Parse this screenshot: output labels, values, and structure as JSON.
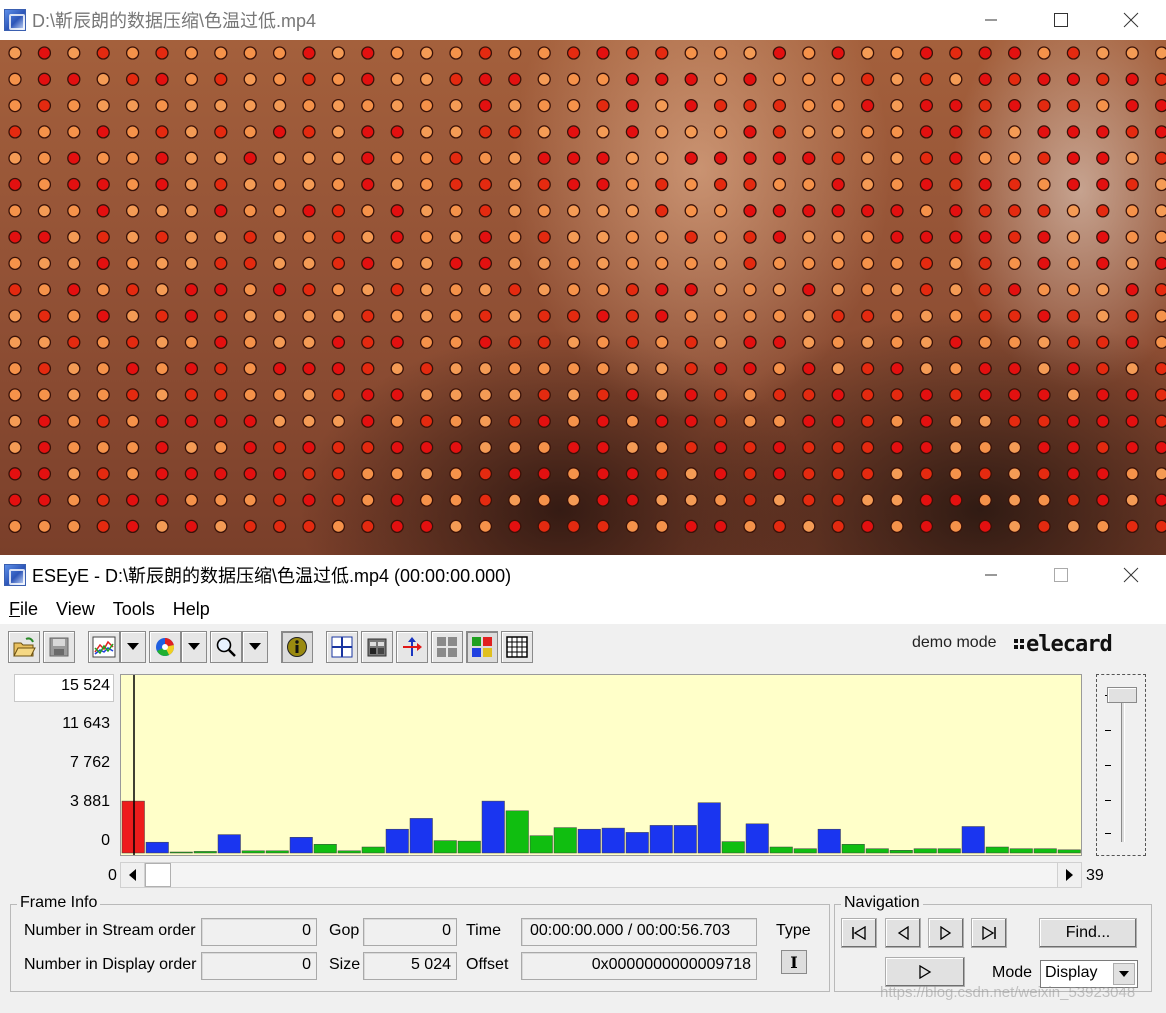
{
  "video_window": {
    "title": "D:\\靳辰朗的数据压缩\\色温过低.mp4",
    "dot_colors": [
      "#e31010",
      "#f5924a",
      "#f49b55",
      "#e42a10"
    ]
  },
  "eseye_window": {
    "title": "ESEyE - D:\\靳辰朗的数据压缩\\色温过低.mp4 (00:00:00.000)"
  },
  "menu": {
    "file": {
      "mnemonic": "F",
      "rest": "ile"
    },
    "view": "View",
    "tools": "Tools",
    "help": "Help"
  },
  "toolbar": {
    "icons": [
      "open-folder-icon",
      "save-icon",
      "chart-icon",
      "color-wheel-icon",
      "zoom-icon",
      "info-icon",
      "crosshair-icon",
      "frame-table-icon",
      "motion-vector-icon",
      "macroblock-grid-icon",
      "macroblock-color-icon",
      "grid-icon"
    ],
    "demo_mode": "demo mode",
    "brand": "elecard"
  },
  "chart_data": {
    "type": "bar",
    "title": "",
    "xlabel": "",
    "ylabel": "",
    "y_ticks": [
      "15 524",
      "11 643",
      "7 762",
      "3 881",
      "0"
    ],
    "ylim": [
      0,
      15524
    ],
    "frame_count_visible": 40,
    "cursor_frame": 0,
    "bars": [
      {
        "frame": 0,
        "value": 4800,
        "type": "I"
      },
      {
        "frame": 1,
        "value": 1000,
        "type": "P"
      },
      {
        "frame": 2,
        "value": 0,
        "type": "B"
      },
      {
        "frame": 3,
        "value": 150,
        "type": "B"
      },
      {
        "frame": 4,
        "value": 1700,
        "type": "P"
      },
      {
        "frame": 5,
        "value": 200,
        "type": "B"
      },
      {
        "frame": 6,
        "value": 200,
        "type": "B"
      },
      {
        "frame": 7,
        "value": 1450,
        "type": "P"
      },
      {
        "frame": 8,
        "value": 800,
        "type": "B"
      },
      {
        "frame": 9,
        "value": 200,
        "type": "B"
      },
      {
        "frame": 10,
        "value": 550,
        "type": "B"
      },
      {
        "frame": 11,
        "value": 2200,
        "type": "P"
      },
      {
        "frame": 12,
        "value": 3200,
        "type": "P"
      },
      {
        "frame": 13,
        "value": 1150,
        "type": "B"
      },
      {
        "frame": 14,
        "value": 1100,
        "type": "B"
      },
      {
        "frame": 15,
        "value": 4800,
        "type": "P"
      },
      {
        "frame": 16,
        "value": 3900,
        "type": "B"
      },
      {
        "frame": 17,
        "value": 1600,
        "type": "B"
      },
      {
        "frame": 18,
        "value": 2350,
        "type": "B"
      },
      {
        "frame": 19,
        "value": 2200,
        "type": "P"
      },
      {
        "frame": 20,
        "value": 2300,
        "type": "P"
      },
      {
        "frame": 21,
        "value": 1900,
        "type": "P"
      },
      {
        "frame": 22,
        "value": 2550,
        "type": "P"
      },
      {
        "frame": 23,
        "value": 2550,
        "type": "P"
      },
      {
        "frame": 24,
        "value": 4650,
        "type": "P"
      },
      {
        "frame": 25,
        "value": 1050,
        "type": "B"
      },
      {
        "frame": 26,
        "value": 2700,
        "type": "P"
      },
      {
        "frame": 27,
        "value": 550,
        "type": "B"
      },
      {
        "frame": 28,
        "value": 400,
        "type": "B"
      },
      {
        "frame": 29,
        "value": 2200,
        "type": "P"
      },
      {
        "frame": 30,
        "value": 800,
        "type": "B"
      },
      {
        "frame": 31,
        "value": 400,
        "type": "B"
      },
      {
        "frame": 32,
        "value": 250,
        "type": "B"
      },
      {
        "frame": 33,
        "value": 400,
        "type": "B"
      },
      {
        "frame": 34,
        "value": 400,
        "type": "B"
      },
      {
        "frame": 35,
        "value": 2450,
        "type": "P"
      },
      {
        "frame": 36,
        "value": 550,
        "type": "B"
      },
      {
        "frame": 37,
        "value": 400,
        "type": "B"
      },
      {
        "frame": 38,
        "value": 400,
        "type": "B"
      },
      {
        "frame": 39,
        "value": 300,
        "type": "B"
      }
    ],
    "colors": {
      "I": "#ee1c1c",
      "P": "#1a35f0",
      "B": "#10be10"
    },
    "background": "#ffffc9",
    "legend": "none",
    "grid": false
  },
  "scrollbar": {
    "min": "0",
    "max": "39"
  },
  "frame_info": {
    "title": "Frame Info",
    "stream_order_label": "Number in Stream order",
    "stream_order_value": "0",
    "display_order_label": "Number in Display order",
    "display_order_value": "0",
    "gop_label": "Gop",
    "gop_value": "0",
    "size_label": "Size",
    "size_value": "5 024",
    "time_label": "Time",
    "time_value": "00:00:00.000 / 00:00:56.703",
    "offset_label": "Offset",
    "offset_value": "0x0000000000009718",
    "type_label": "Type",
    "type_value": "I"
  },
  "navigation": {
    "title": "Navigation",
    "find_label": "Find...",
    "mode_label": "Mode",
    "mode_value": "Display"
  },
  "watermark": "https://blog.csdn.net/weixin_53923048"
}
